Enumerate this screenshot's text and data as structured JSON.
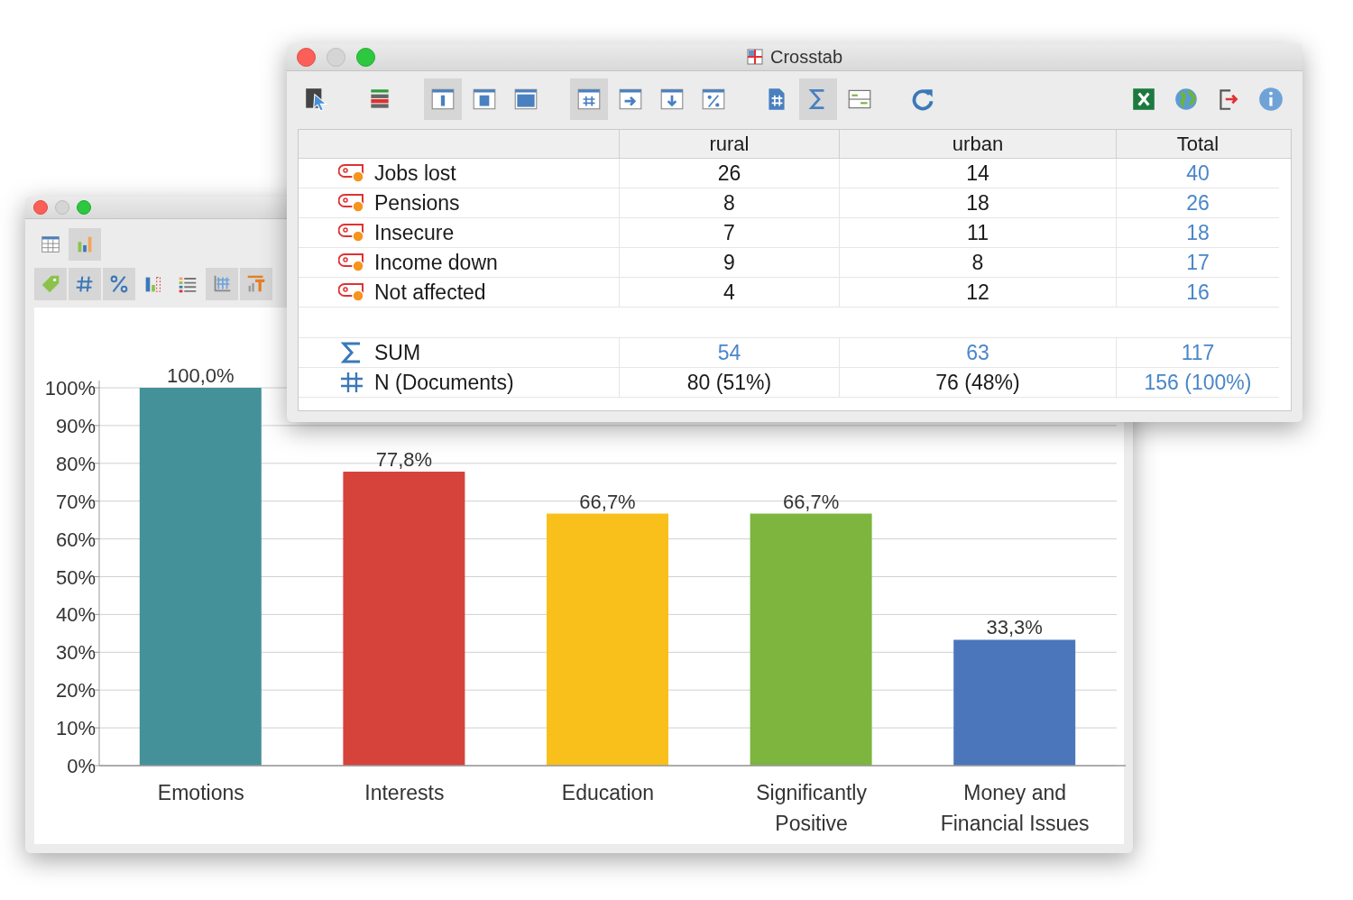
{
  "chart_window": {
    "toolbar_rows": [
      [
        {
          "selected": false
        },
        {
          "selected": true
        }
      ],
      [
        {
          "selected": true
        },
        {
          "selected": true
        },
        {
          "selected": true
        },
        {
          "selected": false
        },
        {
          "selected": false
        },
        {
          "selected": true
        },
        {
          "selected": true
        }
      ]
    ],
    "chart_data": {
      "type": "bar",
      "categories": [
        "Emotions",
        "Interests",
        "Education",
        "Significantly Positive",
        "Money and Financial Issues"
      ],
      "series": [
        {
          "values": [
            100,
            77.8,
            66.7,
            66.7,
            33.3
          ]
        }
      ],
      "grid": true,
      "colors": [
        "#45919a",
        "#d6433a",
        "#f9c01c",
        "#7db53f",
        "#4b76bb"
      ],
      "value_labels": [
        "100,0%",
        "77,8%",
        "66,7%",
        "66,7%",
        "33,3%"
      ],
      "ylim": [
        0,
        100
      ],
      "yticks": [
        {
          "value": 0,
          "label": "0%"
        },
        {
          "value": 10,
          "label": "10%"
        },
        {
          "value": 20,
          "label": "20%"
        },
        {
          "value": 30,
          "label": "30%"
        },
        {
          "value": 40,
          "label": "40%"
        },
        {
          "value": 50,
          "label": "50%"
        },
        {
          "value": 60,
          "label": "60%"
        },
        {
          "value": 70,
          "label": "70%"
        },
        {
          "value": 80,
          "label": "80%"
        },
        {
          "value": 90,
          "label": "90%"
        },
        {
          "value": 100,
          "label": "100%"
        }
      ]
    }
  },
  "crosstab_window": {
    "title": "Crosstab",
    "toolbar_groups": [
      [
        {
          "selected": false
        }
      ],
      [
        {
          "selected": false
        }
      ],
      [
        {
          "selected": true
        },
        {
          "selected": false
        },
        {
          "selected": false
        }
      ],
      [
        {
          "selected": true
        },
        {
          "selected": false
        },
        {
          "selected": false
        },
        {
          "selected": false
        }
      ],
      [
        {
          "selected": false
        },
        {
          "selected": true
        },
        {
          "selected": false
        }
      ],
      [
        {
          "selected": false
        }
      ],
      [
        {
          "selected": false
        },
        {
          "selected": false
        },
        {
          "selected": false
        },
        {
          "selected": false
        }
      ]
    ],
    "table": {
      "columns": [
        "rural",
        "urban",
        "Total"
      ],
      "rows": [
        {
          "kind": "code",
          "label": "Jobs lost",
          "cells": [
            "26",
            "14",
            "40"
          ]
        },
        {
          "kind": "code",
          "label": "Pensions",
          "cells": [
            "8",
            "18",
            "26"
          ]
        },
        {
          "kind": "code",
          "label": "Insecure",
          "cells": [
            "7",
            "11",
            "18"
          ]
        },
        {
          "kind": "code",
          "label": "Income down",
          "cells": [
            "9",
            "8",
            "17"
          ]
        },
        {
          "kind": "code",
          "label": "Not affected",
          "cells": [
            "4",
            "12",
            "16"
          ]
        },
        {
          "kind": "spacer"
        },
        {
          "kind": "sum",
          "label": "SUM",
          "cells": [
            "54",
            "63",
            "117"
          ]
        },
        {
          "kind": "count",
          "label": "N (Documents)",
          "cells": [
            "80 (51%)",
            "76 (48%)",
            "156 (100%)"
          ]
        }
      ]
    }
  }
}
